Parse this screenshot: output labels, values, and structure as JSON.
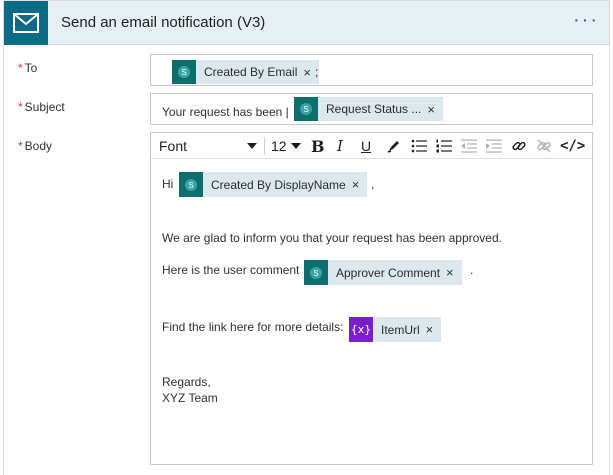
{
  "header": {
    "title": "Send an email notification (V3)",
    "more_label": "···",
    "icon": "mail-icon"
  },
  "fields": {
    "to": {
      "label": "To",
      "required_mark": "*",
      "token": {
        "label": "Created By Email",
        "close": "×",
        "icon": "sharepoint-icon"
      },
      "trailing": ";"
    },
    "subject": {
      "label": "Subject",
      "required_mark": "*",
      "prefix": "Your request has been |",
      "token": {
        "label": "Request Status ...",
        "close": "×",
        "icon": "sharepoint-icon"
      }
    },
    "body": {
      "label": "Body",
      "required_mark": "*"
    }
  },
  "toolbar": {
    "font": "Font",
    "font_size": "12",
    "bold": "B",
    "italic": "I",
    "underline": "U",
    "code": "</>"
  },
  "body_content": {
    "hi": "Hi",
    "hi_token": {
      "label": "Created By DisplayName",
      "close": "×",
      "icon": "sharepoint-icon"
    },
    "hi_trailing": ",",
    "line1": "We are glad to inform you that your request has been approved.",
    "line2_prefix": "Here is the user comment",
    "line2_token": {
      "label": "Approver Comment",
      "close": "×",
      "icon": "sharepoint-icon"
    },
    "line2_trailing": ".",
    "line3_prefix": "Find the link here for more details:",
    "line3_token": {
      "label": "ItemUrl",
      "close": "×",
      "icon_text": "{x}",
      "icon": "expression-icon"
    },
    "closing1": "Regards,",
    "closing2": "XYZ Team"
  },
  "colors": {
    "header_bg": "#e7f0f5",
    "brand": "#0b6a86",
    "sharepoint": "#0e6e6e",
    "expression": "#7a1fc9",
    "token_bg": "#dde8ee",
    "required": "#d13438"
  }
}
